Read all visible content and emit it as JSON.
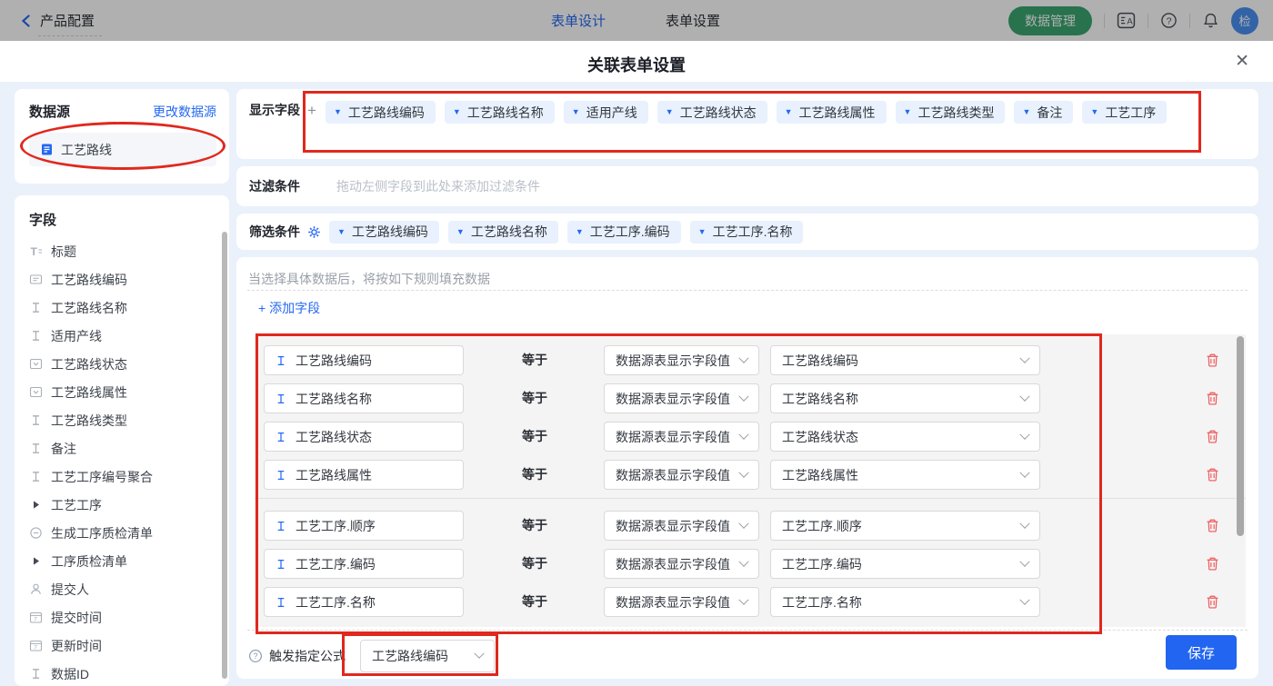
{
  "topbar": {
    "back_label": "产品配置",
    "tabs": [
      {
        "label": "表单设计"
      },
      {
        "label": "表单设置"
      }
    ],
    "data_manage_label": "数据管理",
    "avatar_text": "检"
  },
  "modal": {
    "title": "关联表单设置",
    "close_glyph": "✕"
  },
  "sidebar": {
    "datasource_title": "数据源",
    "change_link": "更改数据源",
    "selected_source": "工艺路线",
    "fields_title": "字段",
    "fields": [
      {
        "label": "标题",
        "icon": "i-title"
      },
      {
        "label": "工艺路线编码",
        "icon": "i-code"
      },
      {
        "label": "工艺路线名称",
        "icon": "i-text"
      },
      {
        "label": "适用产线",
        "icon": "i-text"
      },
      {
        "label": "工艺路线状态",
        "icon": "i-select"
      },
      {
        "label": "工艺路线属性",
        "icon": "i-select"
      },
      {
        "label": "工艺路线类型",
        "icon": "i-text"
      },
      {
        "label": "备注",
        "icon": "i-text"
      },
      {
        "label": "工艺工序编号聚合",
        "icon": "i-text"
      },
      {
        "label": "工艺工序",
        "icon": "i-expand"
      },
      {
        "label": "生成工序质检清单",
        "icon": "i-toggle"
      },
      {
        "label": "工序质检清单",
        "icon": "i-expand"
      },
      {
        "label": "提交人",
        "icon": "i-person"
      },
      {
        "label": "提交时间",
        "icon": "i-calendar"
      },
      {
        "label": "更新时间",
        "icon": "i-calendar"
      },
      {
        "label": "数据ID",
        "icon": "i-text"
      }
    ]
  },
  "main": {
    "display_label": "显示字段",
    "display_tags": [
      "工艺路线编码",
      "工艺路线名称",
      "适用产线",
      "工艺路线状态",
      "工艺路线属性",
      "工艺路线类型",
      "备注",
      "工艺工序"
    ],
    "filter_label": "过滤条件",
    "filter_placeholder": "拖动左侧字段到此处来添加过滤条件",
    "sift_label": "筛选条件",
    "sift_tags": [
      "工艺路线编码",
      "工艺路线名称",
      "工艺工序.编码",
      "工艺工序.名称"
    ],
    "rules_hint": "当选择具体数据后，将按如下规则填充数据",
    "add_field_label": "添加字段",
    "equals_label": "等于",
    "source_value_label": "数据源表显示字段值",
    "rule_groups": [
      {
        "rows": [
          {
            "field": "工艺路线编码",
            "target": "工艺路线编码"
          },
          {
            "field": "工艺路线名称",
            "target": "工艺路线名称"
          },
          {
            "field": "工艺路线状态",
            "target": "工艺路线状态"
          },
          {
            "field": "工艺路线属性",
            "target": "工艺路线属性"
          }
        ]
      },
      {
        "rows": [
          {
            "field": "工艺工序.顺序",
            "target": "工艺工序.顺序"
          },
          {
            "field": "工艺工序.编码",
            "target": "工艺工序.编码"
          },
          {
            "field": "工艺工序.名称",
            "target": "工艺工序.名称"
          }
        ]
      }
    ],
    "trigger_label": "触发指定公式",
    "trigger_value": "工艺路线编码",
    "save_label": "保存"
  },
  "colors": {
    "accent_blue": "#2468f2",
    "green_button": "#3aa571",
    "danger_red": "#f05656",
    "annotation_red": "#e0281e"
  }
}
